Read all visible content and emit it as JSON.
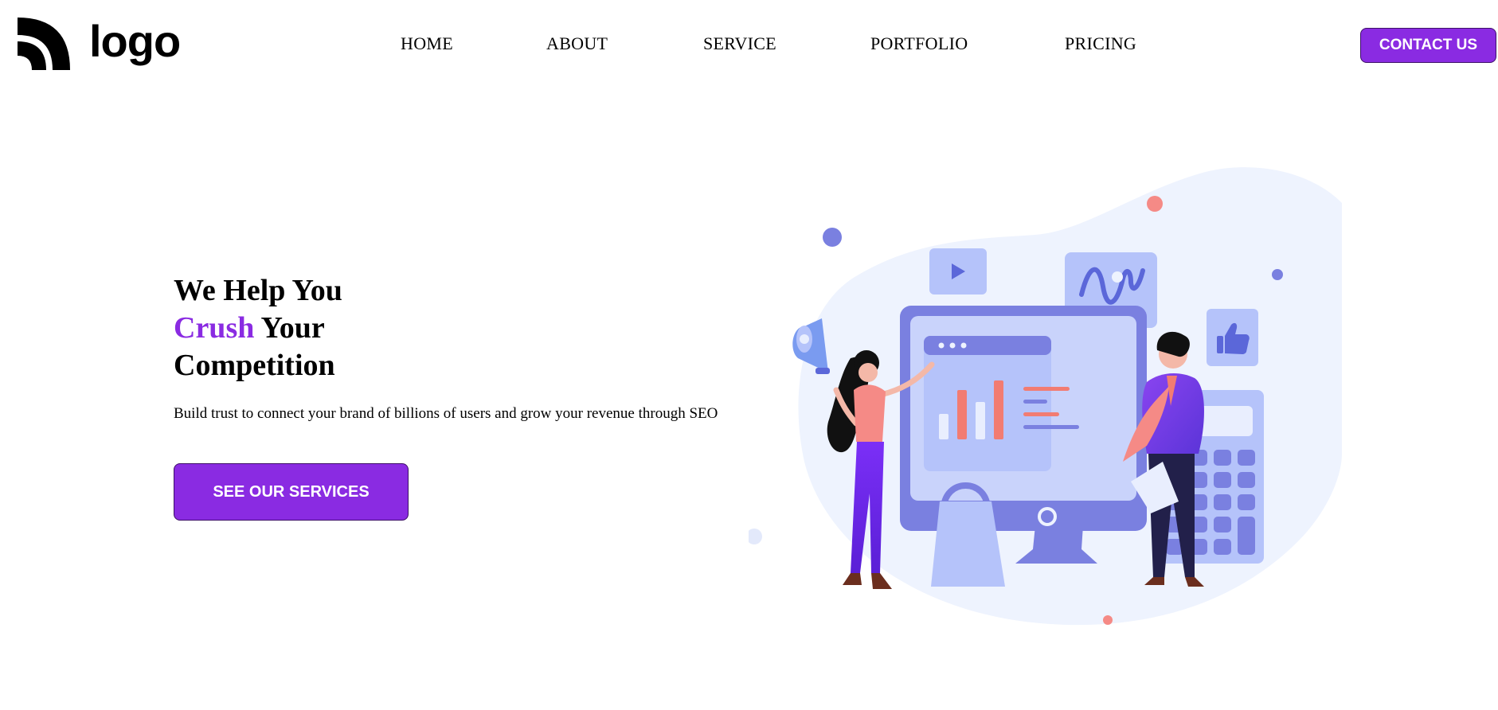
{
  "header": {
    "logo_text": "logo",
    "nav": [
      "HOME",
      "ABOUT",
      "SERVICE",
      "PORTFOLIO",
      "PRICING"
    ],
    "contact_label": "CONTACT US"
  },
  "hero": {
    "headline_line1": "We Help You",
    "headline_accent": "Crush",
    "headline_line2_rest": " Your",
    "headline_line3": "Competition",
    "subtext": "Build trust to connect your brand of billions of users and grow your revenue through SEO",
    "cta_label": "SEE OUR SERVICES"
  },
  "colors": {
    "accent": "#8a2be2",
    "button_border": "#3d1068",
    "illustration_blob": "#eef3fe",
    "illustration_primary": "#7a80e0",
    "illustration_coral": "#f27c72"
  },
  "illustration": {
    "icons": [
      "megaphone-icon",
      "play-icon",
      "wave-chart-icon",
      "thumbs-up-icon",
      "calculator-icon",
      "shopping-bag-icon",
      "monitor-icon"
    ]
  }
}
